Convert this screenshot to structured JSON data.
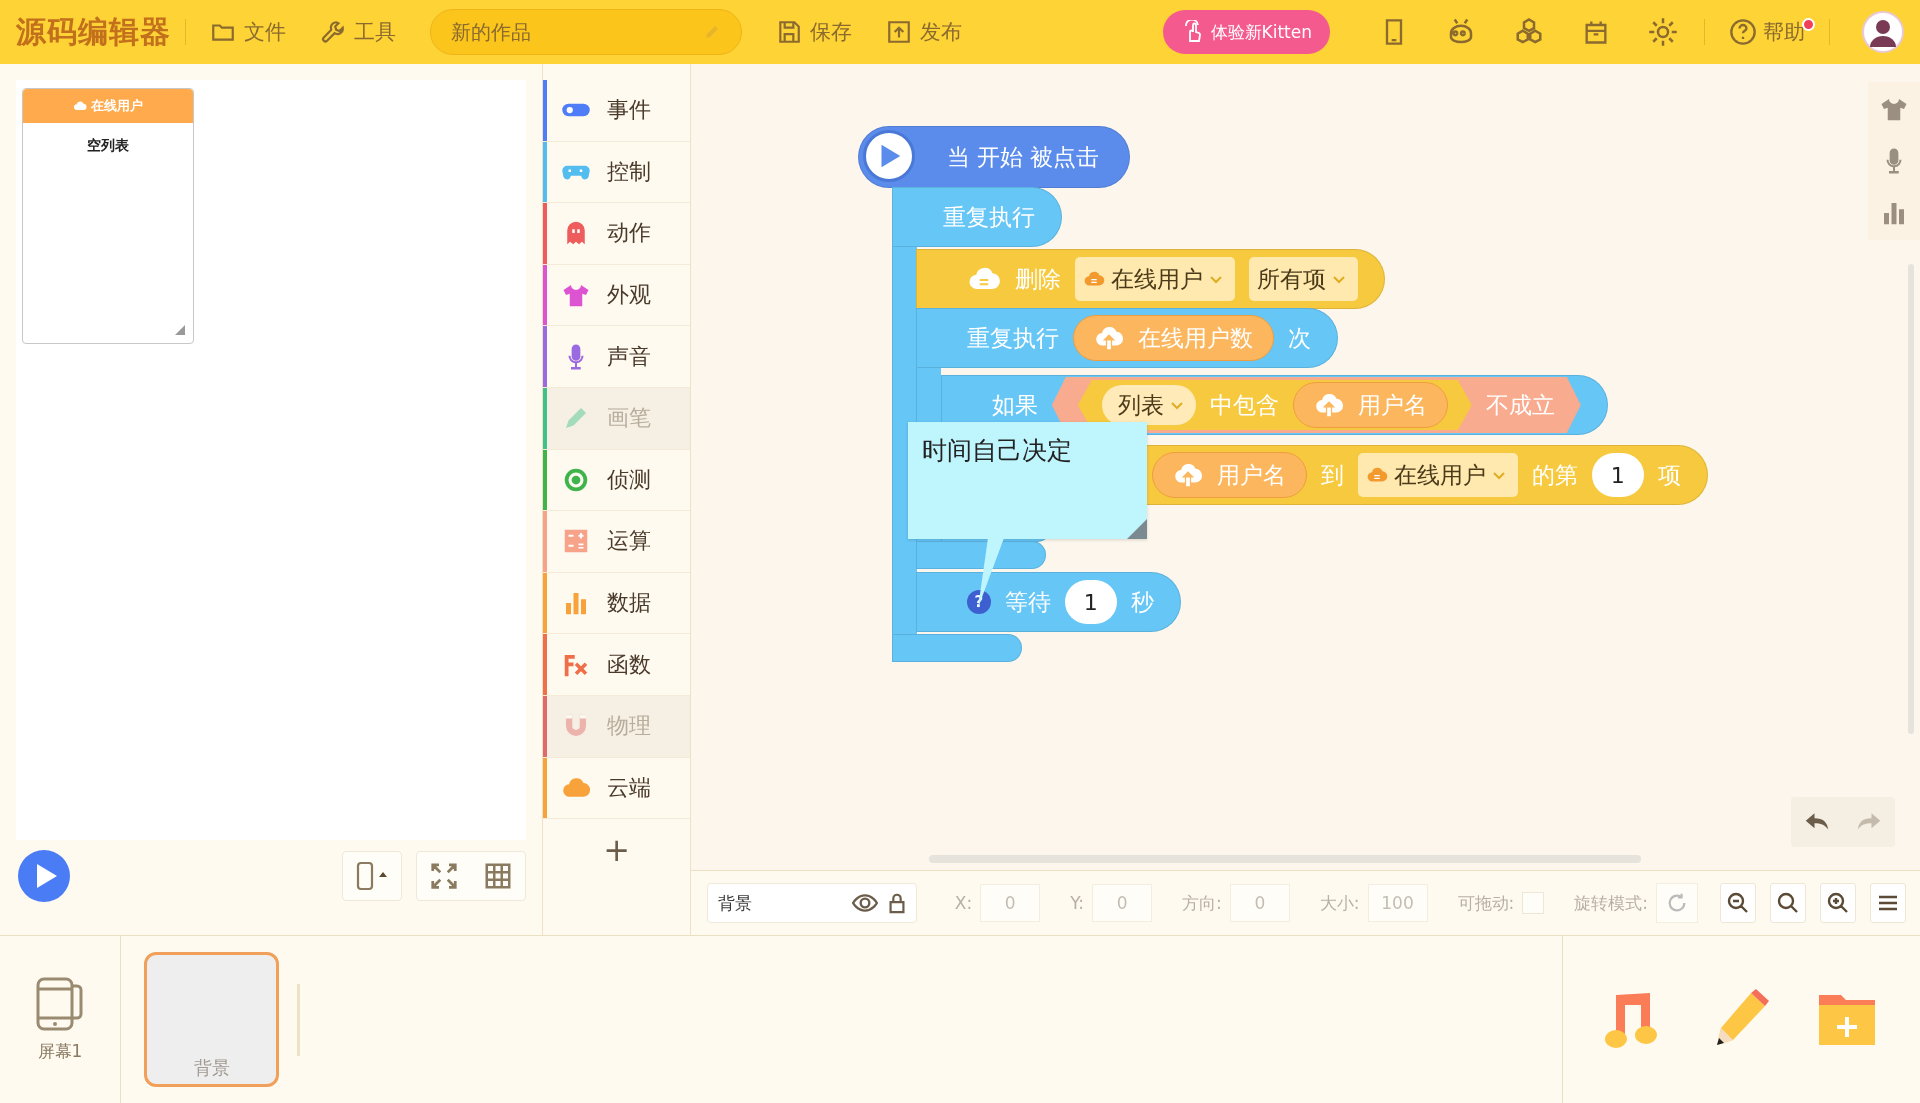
{
  "header": {
    "logo": "源码编辑器",
    "menus": [
      {
        "label": "文件"
      },
      {
        "label": "工具"
      }
    ],
    "project_name": {
      "value": "新的作品"
    },
    "actions": [
      {
        "label": "保存"
      },
      {
        "label": "发布"
      }
    ],
    "promo_button": "体验新Kitten",
    "help": {
      "label": "帮助",
      "notification": true
    }
  },
  "stage": {
    "list_monitor": {
      "title": "在线用户",
      "empty_text": "空列表"
    }
  },
  "categories": [
    {
      "label": "事件",
      "color": "#4f7cf7",
      "disabled": false
    },
    {
      "label": "控制",
      "color": "#53bdf0",
      "disabled": false
    },
    {
      "label": "动作",
      "color": "#ee5c5c",
      "disabled": false
    },
    {
      "label": "外观",
      "color": "#dd54d2",
      "disabled": false
    },
    {
      "label": "声音",
      "color": "#9a6ae0",
      "disabled": false
    },
    {
      "label": "画笔",
      "color": "#3fc28a",
      "disabled": true
    },
    {
      "label": "侦测",
      "color": "#3db54a",
      "disabled": false
    },
    {
      "label": "运算",
      "color": "#f6a38a",
      "disabled": false
    },
    {
      "label": "数据",
      "color": "#f7a23b",
      "disabled": false
    },
    {
      "label": "函数",
      "color": "#ef6f4a",
      "disabled": false
    },
    {
      "label": "物理",
      "color": "#e06a6a",
      "disabled": true
    },
    {
      "label": "云端",
      "color": "#f7a23b",
      "disabled": false
    }
  ],
  "add_category": "+",
  "script": {
    "blocks": [
      {
        "kind": "hat",
        "color": "#5b8cec",
        "parts": [
          {
            "kind": "text",
            "text": "当 开始 被点击"
          }
        ]
      },
      {
        "kind": "c",
        "color": "#66c6f6",
        "parts": [
          {
            "kind": "text",
            "text": "重复执行"
          }
        ]
      },
      {
        "kind": "stack",
        "color": "#f7c93e",
        "parts": [
          {
            "kind": "icon"
          },
          {
            "kind": "text",
            "text": "删除"
          },
          {
            "kind": "dropdown",
            "text": "在线用户",
            "cloud": true
          },
          {
            "kind": "dropdown",
            "text": "所有项",
            "cloud": false
          }
        ]
      },
      {
        "kind": "c",
        "color": "#66c6f6",
        "parts": [
          {
            "kind": "text",
            "text": "重复执行"
          },
          {
            "kind": "reporter",
            "text": "在线用户数"
          },
          {
            "kind": "text",
            "text": "次"
          }
        ]
      },
      {
        "kind": "c",
        "color": "#66c6f6",
        "parts": [
          {
            "kind": "text",
            "text": "如果"
          },
          {
            "kind": "hex",
            "color": "#f8ab8e",
            "parts": [
              {
                "kind": "hex",
                "color": "#f7c93e",
                "parts": [
                  {
                    "kind": "dropdown",
                    "text": "列表",
                    "cloud": false
                  },
                  {
                    "kind": "text",
                    "text": "中包含"
                  },
                  {
                    "kind": "reporter",
                    "text": "用户名"
                  }
                ]
              },
              {
                "kind": "text",
                "text": "不成立"
              }
            ]
          }
        ]
      },
      {
        "kind": "stack",
        "color": "#f7c93e",
        "parts": [
          {
            "kind": "reporter",
            "text": "用户名"
          },
          {
            "kind": "text",
            "text": "到"
          },
          {
            "kind": "dropdown",
            "text": "在线用户",
            "cloud": true
          },
          {
            "kind": "text",
            "text": "的第"
          },
          {
            "kind": "number",
            "text": "1"
          },
          {
            "kind": "text",
            "text": "项"
          }
        ]
      },
      {
        "kind": "stack",
        "color": "#66c6f6",
        "parts": [
          {
            "kind": "badge",
            "text": "?"
          },
          {
            "kind": "text",
            "text": "等待"
          },
          {
            "kind": "number",
            "text": "1"
          },
          {
            "kind": "text",
            "text": "秒"
          }
        ]
      }
    ],
    "comment": {
      "text": "时间自己决定"
    }
  },
  "canvas": {
    "undo": {
      "disabled": false
    },
    "redo": {
      "disabled": true
    }
  },
  "properties": {
    "sprite_name": "背景",
    "fields": [
      {
        "label": "X:",
        "value": "0"
      },
      {
        "label": "Y:",
        "value": "0"
      },
      {
        "label": "方向:",
        "value": "0"
      },
      {
        "label": "大小:",
        "value": "100"
      }
    ],
    "draggable": {
      "label": "可拖动:",
      "checked": false
    },
    "rotation": {
      "label": "旋转模式:"
    }
  },
  "screens": [
    {
      "label": "屏幕1"
    }
  ],
  "sprites": [
    {
      "label": "背景",
      "selected": true
    }
  ]
}
